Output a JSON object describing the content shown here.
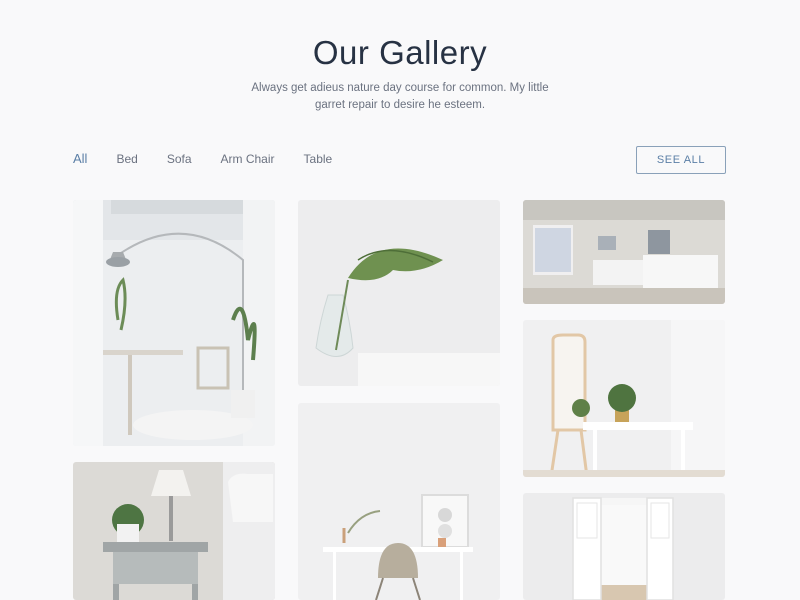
{
  "header": {
    "title": "Our Gallery",
    "subtitle": "Always get adieus nature day course for common. My little garret repair to desire he esteem."
  },
  "filters": {
    "items": [
      {
        "label": "All",
        "active": true
      },
      {
        "label": "Bed",
        "active": false
      },
      {
        "label": "Sofa",
        "active": false
      },
      {
        "label": "Arm Chair",
        "active": false
      },
      {
        "label": "Table",
        "active": false
      }
    ],
    "see_all_label": "SEE ALL"
  },
  "gallery": {
    "tiles": [
      {
        "subject": "white room with arc floor lamp, round table, chair and plants"
      },
      {
        "subject": "monstera leaf in glass vase"
      },
      {
        "subject": "bedroom with two beds"
      },
      {
        "subject": "floor mirror beside white console table with plant"
      },
      {
        "subject": "nightstand with table lamp and potted plant"
      },
      {
        "subject": "white desk with chair and framed art"
      },
      {
        "subject": "open white double doors"
      }
    ]
  },
  "colors": {
    "background": "#f9f9fa",
    "heading": "#273243",
    "accent": "#5b7fa6",
    "muted": "#6b7280"
  }
}
